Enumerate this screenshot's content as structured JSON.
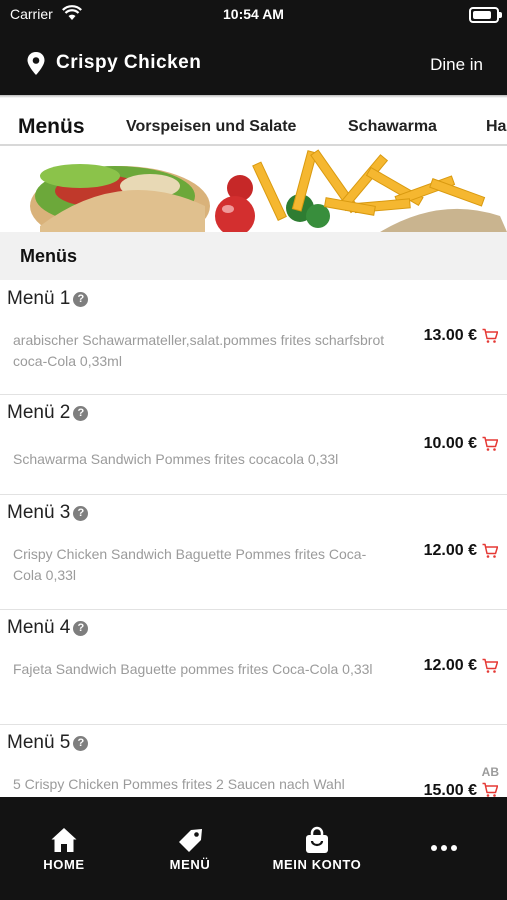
{
  "status_bar": {
    "carrier": "Carrier",
    "time": "10:54 AM"
  },
  "header": {
    "restaurant_name": "Crispy Chicken",
    "mode": "Dine in"
  },
  "tabs": [
    {
      "label": "Menüs",
      "active": true
    },
    {
      "label": "Vorspeisen und Salate",
      "active": false
    },
    {
      "label": "Schawarma",
      "active": false
    },
    {
      "label": "Ha",
      "active": false
    }
  ],
  "section": {
    "title": "Menüs"
  },
  "items": [
    {
      "title": "Menü 1",
      "description": "arabischer Schawarmateller,salat.pommes frites scharfsbrot coca-Cola 0,33ml",
      "price": "13.00 €"
    },
    {
      "title": "Menü 2",
      "description": "Schawarma Sandwich Pommes frites cocacola 0,33l",
      "price": "10.00 €"
    },
    {
      "title": "Menü 3",
      "description": "Crispy Chicken Sandwich Baguette Pommes frites Coca-Cola 0,33l",
      "price": "12.00 €"
    },
    {
      "title": "Menü 4",
      "description": "Fajeta Sandwich Baguette pommes frites Coca-Cola 0,33l",
      "price": "12.00 €"
    },
    {
      "title": "Menü 5",
      "description": "5 Crispy Chicken Pommes frites 2 Saucen nach Wahl",
      "price": "15.00 €"
    }
  ],
  "badge": "AB",
  "help_symbol": "?",
  "bottom_nav": [
    {
      "label": "HOME",
      "icon": "home-icon"
    },
    {
      "label": "MENÜ",
      "icon": "tag-icon"
    },
    {
      "label": "MEIN KONTO",
      "icon": "bag-icon"
    },
    {
      "label": "",
      "icon": "more-icon"
    }
  ],
  "colors": {
    "header_bg": "#131313",
    "cart_red": "#e53935",
    "desc_gray": "#9b9b9b"
  }
}
